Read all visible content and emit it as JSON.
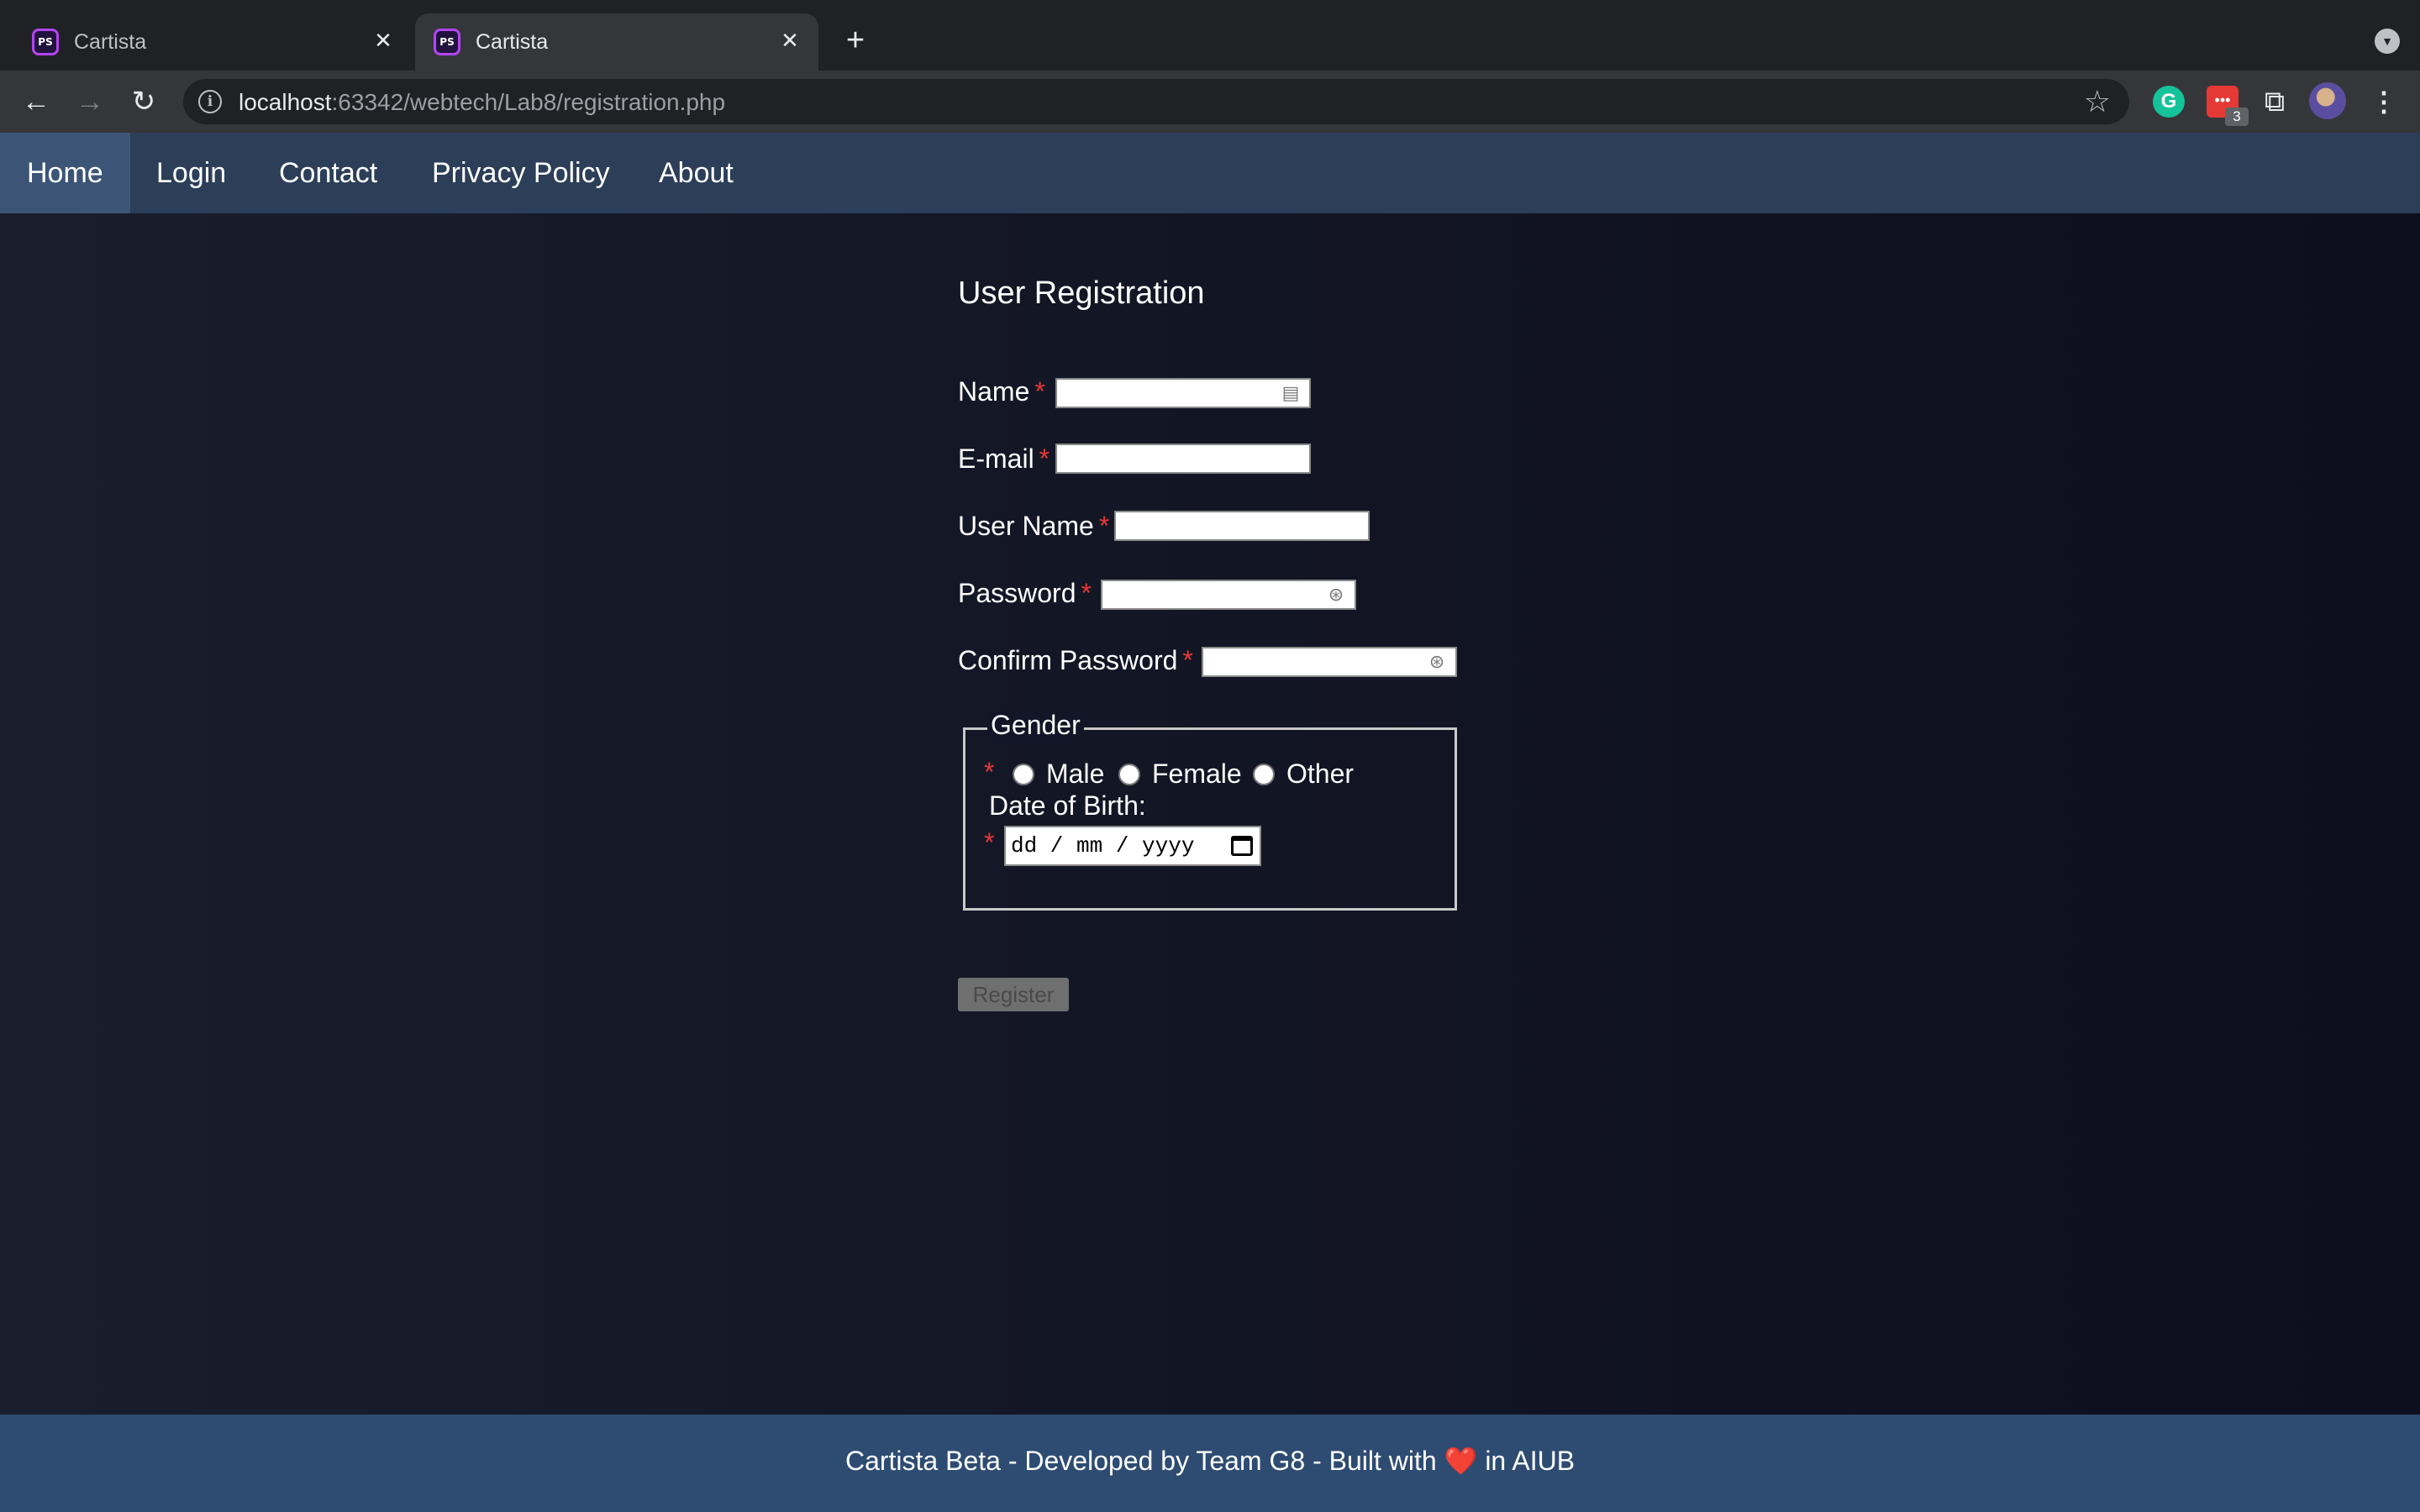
{
  "browser": {
    "tabs": [
      {
        "title": "Cartista",
        "favicon": "PS"
      },
      {
        "title": "Cartista",
        "favicon": "PS"
      }
    ],
    "url_host": "localhost",
    "url_path": ":63342/webtech/Lab8/registration.php",
    "extension_badge": "3"
  },
  "nav": {
    "items": [
      "Home",
      "Login",
      "Contact",
      "Privacy Policy",
      "About"
    ],
    "active": "Home"
  },
  "form": {
    "title": "User Registration",
    "fields": {
      "name_label": "Name",
      "email_label": "E-mail",
      "username_label": "User Name",
      "password_label": "Password",
      "confirm_label": "Confirm Password"
    },
    "required_marker": "*",
    "gender": {
      "legend": "Gender",
      "options": [
        "Male",
        "Female",
        "Other"
      ],
      "dob_label": "Date of Birth:",
      "dob_placeholder": "dd / mm / yyyy"
    },
    "submit_label": "Register"
  },
  "footer": {
    "text_before": "Cartista Beta - Developed by Team G8 - Built with",
    "text_after": "in AIUB",
    "heart": "❤️"
  },
  "colors": {
    "nav_bg": "#2c3e58",
    "nav_active": "#3c5577",
    "footer_bg": "#2e4c72",
    "required": "#e53935"
  }
}
